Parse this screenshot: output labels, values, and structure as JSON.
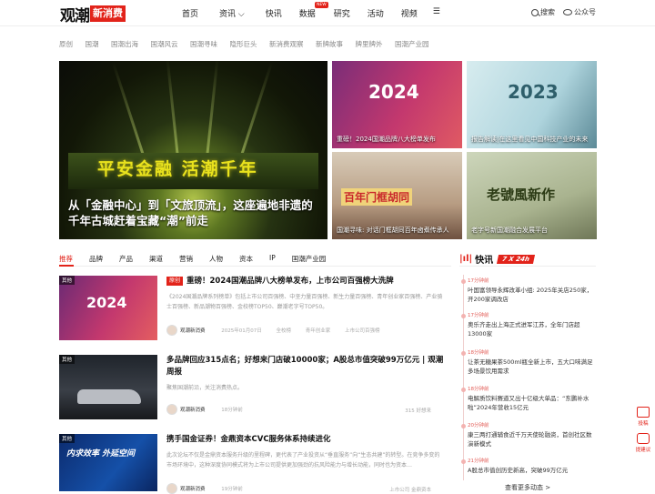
{
  "header": {
    "logo_text": "观潮",
    "logo_badge": "新消费",
    "nav": [
      "首页",
      "资讯",
      "快讯",
      "数据",
      "研究",
      "活动",
      "视频"
    ],
    "new_badge": "NEW",
    "search_label": "搜索",
    "wechat_label": "公众号"
  },
  "subnav": [
    "原创",
    "国潮",
    "国潮出海",
    "国潮风云",
    "国潮寻味",
    "隐形巨头",
    "新消费观察",
    "新牌故事",
    "牌里牌外",
    "国潮产业园"
  ],
  "hero": {
    "title": "从「金融中心」到「文旅顶流」，这座遍地非遗的千年古城赶着宝藏“潮”前走",
    "wall_text": "平安金融 活潮千年"
  },
  "tiles": [
    {
      "caption": "重磅！2024国潮品牌八大榜单发布",
      "big": "2024"
    },
    {
      "caption": "报告解读|在这里看见中国科技产业的未来",
      "big": "2023"
    },
    {
      "caption": "国潮寻味: 对话门框胡同百年卤煮传承人",
      "big": "百年门框胡同"
    },
    {
      "caption": "老字号新国潮融合发展平台",
      "big": "老號風新作"
    }
  ],
  "tabs": [
    "推荐",
    "品牌",
    "产品",
    "渠道",
    "营销",
    "人物",
    "资本",
    "IP",
    "国潮产业园"
  ],
  "articles": [
    {
      "tag": "其他",
      "badge": "原创",
      "title": "重磅！2024国潮品牌八大榜单发布，上市公司百强榜大洗牌",
      "summary": "《2024国潮品牌系列榜单》包括上市公司百强榜、中坚力量百强榜、新生力量百强榜、青年创业家百强榜、产业骑士百强榜、新品潮物百强榜、金校榜TOP50、巅潮老字号TOP50。",
      "author": "观潮新消费",
      "date": "2025年01月07日",
      "labels": [
        "全校榜",
        "青年创业家",
        "上市公司百强榜"
      ],
      "right": ""
    },
    {
      "tag": "其他",
      "badge": "",
      "title": "多品牌回应315点名；好想来门店破10000家；A股总市值突破99万亿元 | 观潮周报",
      "summary": "聚焦国潮前沿，关注消费热点。",
      "author": "观潮新消费",
      "date": "18分钟前",
      "labels": [],
      "right": "315   好想来"
    },
    {
      "tag": "其他",
      "badge": "",
      "title": "携手国金证券！金鼎资本CVC服务体系持续进化",
      "summary": "此次论坛不仅是金鼎资本服务升级的里程碑，更代表了产业投资从“垂直服务”向“生态共建”的转型。在竞争多变的市场环境中，这种深度协同模式将为上市公司提供更加强劲的抗风险能力与增长动能，同时也为资本…",
      "author": "观潮新消费",
      "date": "19分钟前",
      "labels": [],
      "right": "上市公司   金鼎资本"
    }
  ],
  "article_thumbs": [
    "2024",
    "",
    "内求效率 外延空间"
  ],
  "kuaixun": {
    "title": "快讯",
    "badge": "7 X 24h",
    "items": [
      {
        "time": "17分钟前",
        "text": "叶国富领导永辉改革小组: 2025年关店250家，开200家调改店"
      },
      {
        "time": "17分钟前",
        "text": "奥乐齐走出上海正式进军江苏，全年门店超13000家"
      },
      {
        "time": "18分钟前",
        "text": "让茶无糖果茶500ml瓶全新上市，五大口味满足多场景饮用需求"
      },
      {
        "time": "18分钟前",
        "text": "电解质饮料赛道又出十亿级大单品：“东鹏补水啦”2024年营收15亿元"
      },
      {
        "time": "20分钟前",
        "text": "康三两打通辅食近千万天使轮融资，首创社区数演新模式"
      },
      {
        "time": "21分钟前",
        "text": "A股总市值创历史新高，突破99万亿元"
      }
    ],
    "more": "查看更多动态 >"
  },
  "float_tools": [
    "投稿",
    "提建议"
  ]
}
